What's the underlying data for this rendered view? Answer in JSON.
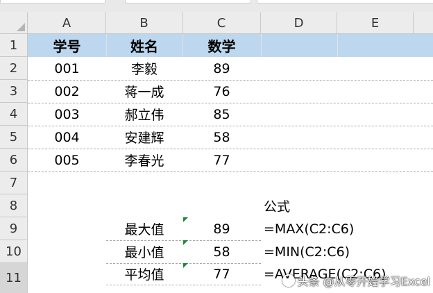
{
  "columns": [
    "A",
    "B",
    "C",
    "D",
    "E"
  ],
  "rows": [
    "1",
    "2",
    "3",
    "4",
    "5",
    "6",
    "7",
    "8",
    "9",
    "10",
    "11"
  ],
  "header_row": {
    "id": "学号",
    "name": "姓名",
    "math": "数学"
  },
  "students": [
    {
      "id": "001",
      "name": "李毅",
      "score": "89"
    },
    {
      "id": "002",
      "name": "蒋一成",
      "score": "76"
    },
    {
      "id": "003",
      "name": "郝立伟",
      "score": "85"
    },
    {
      "id": "004",
      "name": "安建辉",
      "score": "58"
    },
    {
      "id": "005",
      "name": "李春光",
      "score": "77"
    }
  ],
  "formula_header": "公式",
  "summary": [
    {
      "label": "最大值",
      "value": "89",
      "formula": "=MAX(C2:C6)"
    },
    {
      "label": "最小值",
      "value": "58",
      "formula": "=MIN(C2:C6)"
    },
    {
      "label": "平均值",
      "value": "77",
      "formula": "=AVERAGE(C2:C6)"
    }
  ],
  "watermark": "头条 @从零开始学习Excel",
  "colors": {
    "header_band": "#bdd7ee",
    "error_marker": "#1e8a3a"
  }
}
